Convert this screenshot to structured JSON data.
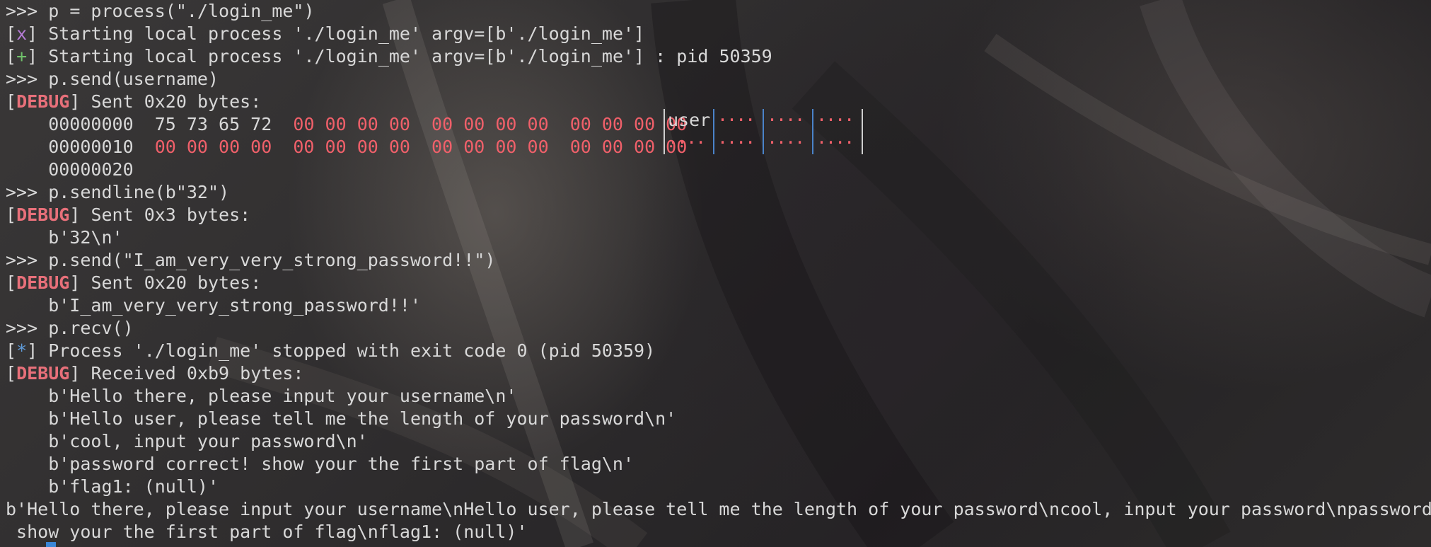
{
  "terminal": {
    "lines": [
      {
        "prompt": ">>> ",
        "text": "p = process(\"./login_me\")"
      },
      {
        "marker": "x",
        "text": " Starting local process './login_me' argv=[b'./login_me']"
      },
      {
        "marker": "+",
        "text": " Starting local process './login_me' argv=[b'./login_me'] : pid 50359"
      },
      {
        "prompt": ">>> ",
        "text": "p.send(username)"
      },
      {
        "marker": "DEBUG",
        "text": " Sent 0x20 bytes:"
      },
      {
        "hex_offset": "    00000000  ",
        "hex_plain": "75 73 65 72  ",
        "hex_red": "00 00 00 00  00 00 00 00  00 00 00 00"
      },
      {
        "hex_offset": "    00000010  ",
        "hex_plain": "",
        "hex_red": "00 00 00 00  00 00 00 00  00 00 00 00  00 00 00 00"
      },
      {
        "hex_offset": "    00000020",
        "hex_plain": "",
        "hex_red": ""
      },
      {
        "prompt": ">>> ",
        "text": "p.sendline(b\"32\")"
      },
      {
        "marker": "DEBUG",
        "text": " Sent 0x3 bytes:"
      },
      {
        "plain": "    b'32\\n'"
      },
      {
        "prompt": ">>> ",
        "text": "p.send(\"I_am_very_very_strong_password!!\")"
      },
      {
        "marker": "DEBUG",
        "text": " Sent 0x20 bytes:"
      },
      {
        "plain": "    b'I_am_very_very_strong_password!!'"
      },
      {
        "prompt": ">>> ",
        "text": "p.recv()"
      },
      {
        "marker": "*",
        "text": " Process './login_me' stopped with exit code 0 (pid 50359)"
      },
      {
        "marker": "DEBUG",
        "text": " Received 0xb9 bytes:"
      },
      {
        "plain": "    b'Hello there, please input your username\\n'"
      },
      {
        "plain": "    b'Hello user, please tell me the length of your password\\n'"
      },
      {
        "plain": "    b'cool, input your password\\n'"
      },
      {
        "plain": "    b'password correct! show your the first part of flag\\n'"
      },
      {
        "plain": "    b'flag1: (null)'"
      },
      {
        "plain": "b'Hello there, please input your username\\nHello user, please tell me the length of your password\\ncool, input your password\\npassword correct!"
      },
      {
        "plain": " show your the first part of flag\\nflag1: (null)'"
      }
    ],
    "hex_ascii": {
      "row1": [
        "user",
        "····",
        "····",
        "····"
      ],
      "row2": [
        "····",
        "····",
        "····",
        "····"
      ]
    }
  },
  "colors": {
    "marker_x": "#b57bd6",
    "marker_plus": "#6fbf6a",
    "marker_star": "#5f9bd9",
    "marker_debug": "#e8707a",
    "hex_zero": "#f0606a",
    "cursor": "#3a86d6"
  }
}
